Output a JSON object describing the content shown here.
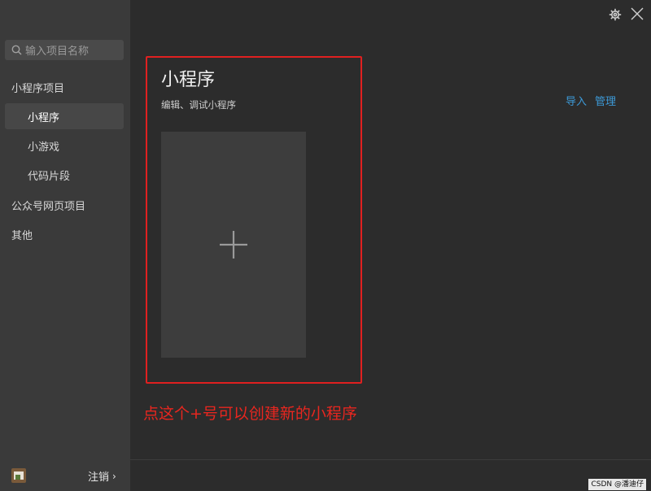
{
  "sidebar": {
    "search": {
      "placeholder": "输入项目名称",
      "icon": "search-icon"
    },
    "items": [
      {
        "label": "小程序项目",
        "level": "top",
        "active": false
      },
      {
        "label": "小程序",
        "level": "sub",
        "active": true
      },
      {
        "label": "小游戏",
        "level": "sub",
        "active": false
      },
      {
        "label": "代码片段",
        "level": "sub",
        "active": false
      },
      {
        "label": "公众号网页项目",
        "level": "top",
        "active": false
      },
      {
        "label": "其他",
        "level": "top",
        "active": false
      }
    ],
    "logout_label": "注销",
    "logout_chevron": "›"
  },
  "window": {
    "settings_icon": "gear-icon",
    "close_icon": "close-icon"
  },
  "main": {
    "title": "小程序",
    "subtitle": "编辑、调试小程序",
    "add_tile_icon": "plus-icon",
    "actions": {
      "import_label": "导入",
      "manage_label": "管理"
    }
  },
  "annotation": {
    "text": "点这个+号可以创建新的小程序",
    "color": "#e8261f"
  },
  "watermark": "CSDN @潘迪仔",
  "colors": {
    "sidebar_bg": "#3a3a3a",
    "main_bg": "#2c2c2c",
    "tile_bg": "#3d3d3d",
    "link": "#3d9ad8",
    "highlight": "#e02020"
  }
}
